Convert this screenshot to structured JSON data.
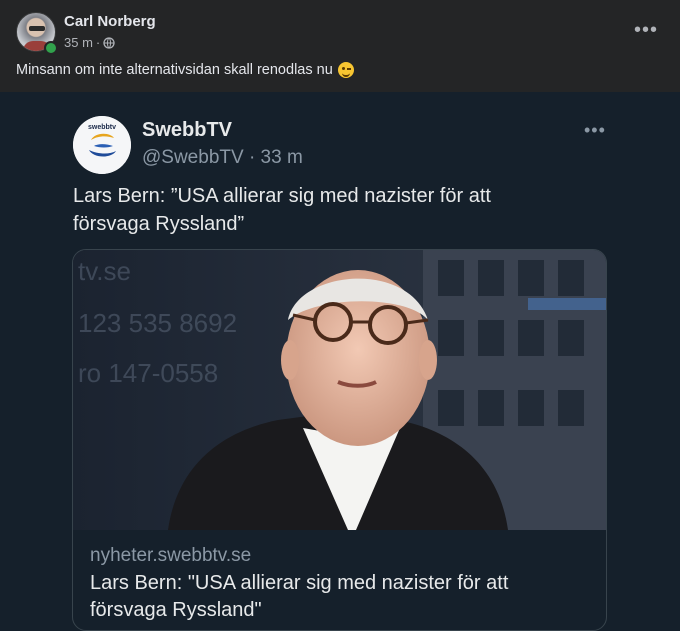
{
  "post": {
    "author": "Carl Norberg",
    "time": "35 m",
    "separator": "·",
    "privacy_icon": "globe-icon",
    "more_icon": "•••",
    "text": "Minsann om inte alternativsidan skall renodlas nu",
    "emoji": "winking-face"
  },
  "tweet": {
    "name": "SwebbTV",
    "handle_time": "@SwebbTV · 33 m",
    "more_icon": "•••",
    "text": "Lars Bern: ”USA allierar sig med nazister för att försvaga Ryssland”",
    "card": {
      "bg_text_1": "tv.se",
      "bg_text_2": "123 535 8692",
      "bg_text_3": "ro 147-0558",
      "domain": "nyheter.swebbtv.se",
      "title": "Lars Bern: \"USA allierar sig med nazister för att försvaga Ryssland\""
    }
  },
  "colors": {
    "facebook_bg": "#242526",
    "twitter_bg": "#15202b",
    "text_primary": "#e4e6eb",
    "text_secondary": "#b0b3b8",
    "online": "#31a24c"
  }
}
